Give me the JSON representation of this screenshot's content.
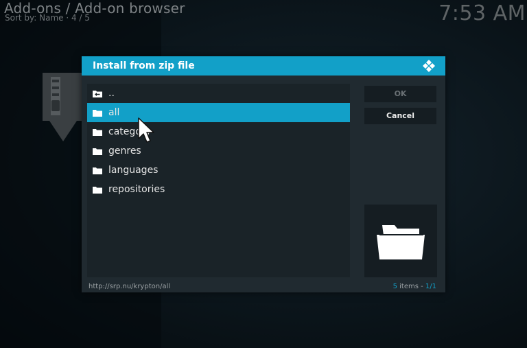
{
  "header": {
    "title": "Add-ons / Add-on browser",
    "sort": "Sort by: Name  ·  4 / 5",
    "clock": "7:53 AM"
  },
  "dialog": {
    "title": "Install from zip file",
    "items": [
      {
        "label": "..",
        "icon": "folder-up-icon"
      },
      {
        "label": "all",
        "icon": "folder-icon",
        "selected": true
      },
      {
        "label": "category",
        "icon": "folder-icon"
      },
      {
        "label": "genres",
        "icon": "folder-icon"
      },
      {
        "label": "languages",
        "icon": "folder-icon"
      },
      {
        "label": "repositories",
        "icon": "folder-icon"
      }
    ],
    "ok_label": "OK",
    "cancel_label": "Cancel",
    "path": "http://srp.nu/krypton/all",
    "count_items": "5",
    "count_items_suffix": " items - ",
    "count_page": "1/1"
  },
  "colors": {
    "accent": "#12a0c8",
    "dialog_bg": "#202a30",
    "panel_bg": "#1a2328"
  }
}
